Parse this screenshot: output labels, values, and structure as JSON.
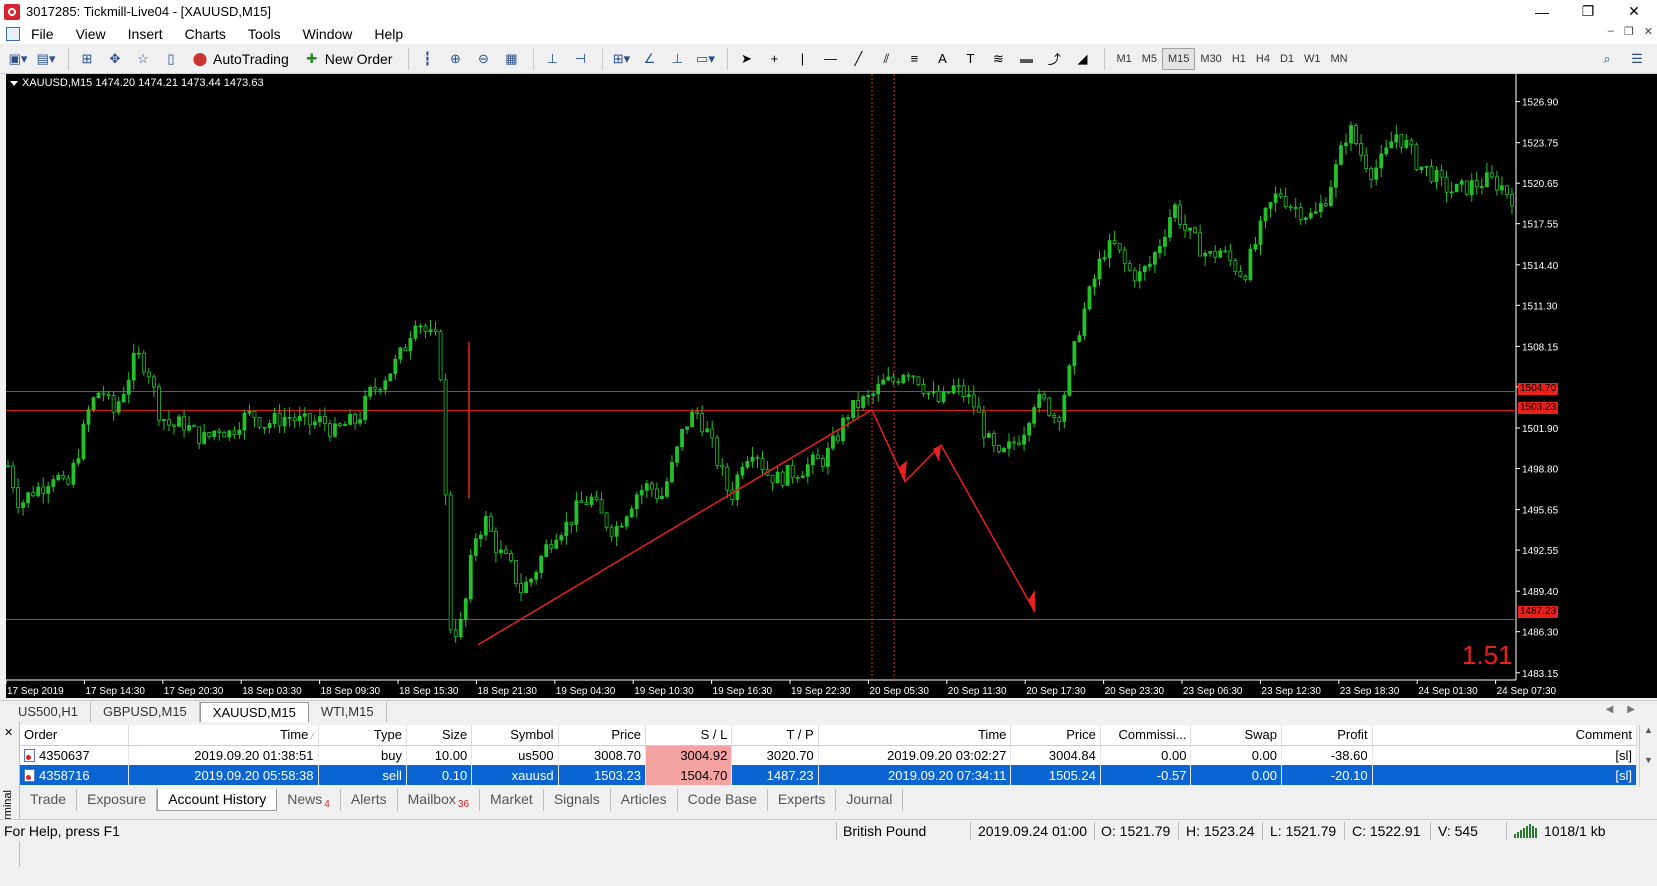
{
  "window": {
    "title": "3017285: Tickmill-Live04 - [XAUUSD,M15]",
    "minimize": "—",
    "maximize": "❐",
    "close": "✕"
  },
  "menu": [
    "File",
    "View",
    "Insert",
    "Charts",
    "Tools",
    "Window",
    "Help"
  ],
  "toolbar": {
    "autotrading": "AutoTrading",
    "new_order": "New Order",
    "timeframes": [
      "M1",
      "M5",
      "M15",
      "M30",
      "H1",
      "H4",
      "D1",
      "W1",
      "MN"
    ],
    "active_timeframe": "M15"
  },
  "chart": {
    "symbol_info": "XAUUSD,M15  1474.20 1474.21 1473.44 1473.63",
    "corner_value": "1.51",
    "colors": {
      "background": "#000000",
      "bull": "#22c12a",
      "line": "#e8201e",
      "axis_text": "#ffffff"
    }
  },
  "chart_data": {
    "type": "candlestick",
    "symbol": "XAUUSD",
    "timeframe": "M15",
    "y_ticks": [
      1526.9,
      1523.75,
      1520.65,
      1517.55,
      1514.4,
      1511.3,
      1508.15,
      1505.05,
      1501.9,
      1498.8,
      1495.65,
      1492.55,
      1489.4,
      1486.3,
      1483.15
    ],
    "ylim": [
      1482.6,
      1528.4
    ],
    "x_ticks": [
      "17 Sep 2019",
      "17 Sep 14:30",
      "17 Sep 20:30",
      "18 Sep 03:30",
      "18 Sep 09:30",
      "18 Sep 15:30",
      "18 Sep 21:30",
      "19 Sep 04:30",
      "19 Sep 10:30",
      "19 Sep 16:30",
      "19 Sep 22:30",
      "20 Sep 05:30",
      "20 Sep 11:30",
      "20 Sep 17:30",
      "20 Sep 23:30",
      "23 Sep 06:30",
      "23 Sep 12:30",
      "23 Sep 18:30",
      "24 Sep 01:30",
      "24 Sep 07:30"
    ],
    "close_path": [
      1499,
      1496,
      1497,
      1497.5,
      1498.5,
      1497,
      1500,
      1503.5,
      1505,
      1503,
      1505,
      1507.5,
      1506.5,
      1503,
      1502,
      1502.3,
      1501.5,
      1501,
      1502,
      1501.5,
      1502.6,
      1503,
      1502.2,
      1502.5,
      1502.8,
      1502.4,
      1502.2,
      1502.5,
      1501.5,
      1502.2,
      1502.5,
      1504.5,
      1505.5,
      1506.5,
      1508,
      1510.5,
      1509,
      1508.5,
      1486,
      1487,
      1493.5,
      1494.8,
      1492.5,
      1491.5,
      1489.5,
      1490.5,
      1492.5,
      1494,
      1494.5,
      1496,
      1496.5,
      1495,
      1494,
      1495.5,
      1497,
      1497.5,
      1496.5,
      1499,
      1502,
      1503.2,
      1501.5,
      1499,
      1496.5,
      1499.5,
      1500.5,
      1498.5,
      1498,
      1498.4,
      1498.7,
      1499.2,
      1499.5,
      1501,
      1503,
      1503.8,
      1504.2,
      1505.3,
      1505.5,
      1506.5,
      1505.8,
      1504.5,
      1503.8,
      1505,
      1504.5,
      1503.5,
      1501,
      1499.5,
      1500.5,
      1501.5,
      1504,
      1503.8,
      1502.5,
      1506,
      1510,
      1512.8,
      1515.5,
      1515.8,
      1514,
      1513.5,
      1514.5,
      1516.5,
      1519,
      1517,
      1516,
      1515,
      1515.5,
      1514.5,
      1513.6,
      1516,
      1518.5,
      1520,
      1519,
      1518.5,
      1518,
      1519.5,
      1522,
      1525,
      1523,
      1521.5,
      1522.5,
      1524.5,
      1523.5,
      1522,
      1521.5,
      1520.5,
      1520,
      1520.3,
      1520.6,
      1520.9,
      1520.5,
      1519.6
    ],
    "horizontal_lines": [
      1504.7,
      1503.23,
      1487.23
    ],
    "price_tags": [
      "1504.70",
      "1503.23",
      "1487.23"
    ],
    "trendline": [
      [
        1485.3
      ],
      [
        1503.3
      ]
    ],
    "vertical_lines_times": [
      "20 Sep 05:30",
      "20 Sep 07:34"
    ]
  },
  "chart_tabs": [
    "US500,H1",
    "GBPUSD,M15",
    "XAUUSD,M15",
    "WTI,M15"
  ],
  "active_chart_tab": "XAUUSD,M15",
  "orders": {
    "headers": [
      "Order",
      "Time",
      "Type",
      "Size",
      "Symbol",
      "Price",
      "S / L",
      "T / P",
      "Time",
      "Price",
      "Commissi...",
      "Swap",
      "Profit",
      "Comment"
    ],
    "rows": [
      [
        "4350637",
        "2019.09.20 01:38:51",
        "buy",
        "10.00",
        "us500",
        "3008.70",
        "3004.92",
        "3020.70",
        "2019.09.20 03:02:27",
        "3004.84",
        "0.00",
        "0.00",
        "-38.60",
        "[sl]"
      ],
      [
        "4358716",
        "2019.09.20 05:58:38",
        "sell",
        "0.10",
        "xauusd",
        "1503.23",
        "1504.70",
        "1487.23",
        "2019.09.20 07:34:11",
        "1505.24",
        "-0.57",
        "0.00",
        "-20.10",
        "[sl]"
      ]
    ]
  },
  "terminal": {
    "label": "Terminal",
    "tabs": [
      "Trade",
      "Exposure",
      "Account History",
      "News",
      "Alerts",
      "Mailbox",
      "Market",
      "Signals",
      "Articles",
      "Code Base",
      "Experts",
      "Journal"
    ],
    "news_badge": "4",
    "mailbox_badge": "36",
    "active_tab": "Account History"
  },
  "status": {
    "help": "For Help, press F1",
    "profile": "British Pound",
    "datetime": "2019.09.24 01:00",
    "open": "O: 1521.79",
    "high": "H: 1523.24",
    "low": "L: 1521.79",
    "close": "C: 1522.91",
    "volume": "V: 545",
    "traffic": "1018/1 kb"
  }
}
